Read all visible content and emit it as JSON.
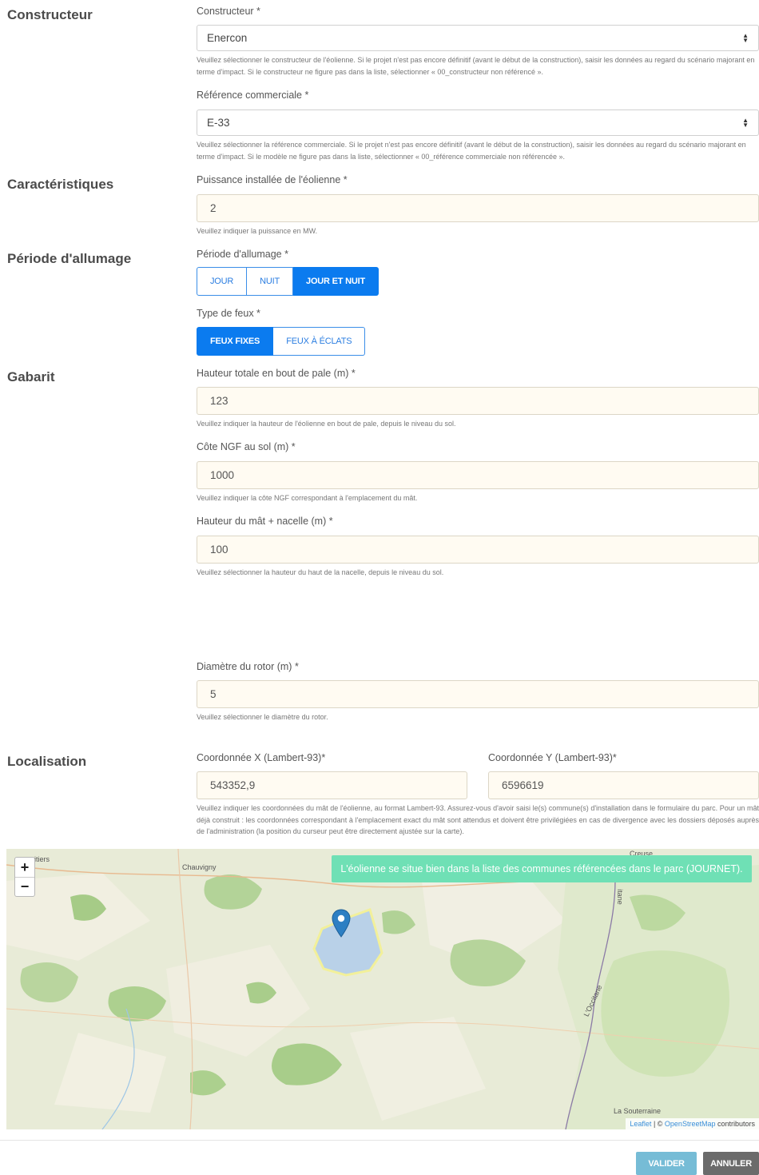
{
  "sections": {
    "constructeur": "Constructeur",
    "caracteristiques": "Caractéristiques",
    "periode": "Période d'allumage",
    "gabarit": "Gabarit",
    "localisation": "Localisation"
  },
  "constructeur": {
    "label": "Constructeur *",
    "value": "Enercon",
    "help": "Veuillez sélectionner le constructeur de l'éolienne. Si le projet n'est pas encore définitif (avant le début de la construction), saisir les données au regard du scénario majorant en terme d'impact. Si le constructeur ne figure pas dans la liste, sélectionner « 00_constructeur non référencé »."
  },
  "reference": {
    "label": "Référence commerciale *",
    "value": "E-33",
    "help": "Veuillez sélectionner la référence commerciale. Si le projet n'est pas encore définitif (avant le début de la construction), saisir les données au regard du scénario majorant en terme d'impact. Si le modèle ne figure pas dans la liste, sélectionner « 00_référence commerciale non référencée »."
  },
  "puissance": {
    "label": "Puissance installée de l'éolienne *",
    "value": "2",
    "help": "Veuillez indiquer la puissance en MW."
  },
  "periode": {
    "label": "Période d'allumage *",
    "options": [
      "JOUR",
      "NUIT",
      "JOUR ET NUIT"
    ],
    "selected": "JOUR ET NUIT"
  },
  "type_feux": {
    "label": "Type de feux *",
    "options": [
      "FEUX FIXES",
      "FEUX À ÉCLATS"
    ],
    "selected": "FEUX FIXES"
  },
  "hauteur_totale": {
    "label": "Hauteur totale en bout de pale (m) *",
    "value": "123",
    "help": "Veuillez indiquer la hauteur de l'éolienne en bout de pale, depuis le niveau du sol."
  },
  "cote_ngf": {
    "label": "Côte NGF au sol (m) *",
    "value": "1000",
    "help": "Veuillez indiquer la côte NGF correspondant à l'emplacement du mât."
  },
  "hauteur_mat": {
    "label": "Hauteur du mât + nacelle (m) *",
    "value": "100",
    "help": "Veuillez sélectionner la hauteur du haut de la nacelle, depuis le niveau du sol."
  },
  "diametre": {
    "label": "Diamètre du rotor (m) *",
    "value": "5",
    "help": "Veuillez sélectionner le diamètre du rotor."
  },
  "coord_x": {
    "label": "Coordonnée X (Lambert-93)*",
    "value": "543352,9"
  },
  "coord_y": {
    "label": "Coordonnée Y (Lambert-93)*",
    "value": "6596619"
  },
  "coord_help": "Veuillez indiquer les coordonnées du mât de l'éolienne, au format Lambert-93. Assurez-vous d'avoir saisi le(s) commune(s) d'installation dans le formulaire du parc. Pour un mât déjà construit : les coordonnées correspondant à l'emplacement exact du mât sont attendus et doivent être privilégiées en cas de divergence avec les dossiers déposés auprès de l'administration (la position du curseur peut être directement ajustée sur la carte).",
  "map": {
    "zoom_in": "+",
    "zoom_out": "−",
    "notice": "L'éolienne se situe bien dans la liste des communes référencées dans le parc (JOURNET).",
    "places": {
      "poitiers": "oitiers",
      "chauvigny": "Chauvigny",
      "creuse": "Creuse",
      "souterraine": "La Souterraine",
      "occitane": "L'Occitane",
      "itane": "itane"
    },
    "attribution": {
      "leaflet": "Leaflet",
      "sep": " | © ",
      "osm": "OpenStreetMap",
      "contributors": " contributors"
    },
    "marker_icon": "map-marker-icon",
    "colors": {
      "notice_bg": "#6fe0b5",
      "marker": "#2d7fc3",
      "zone_fill": "#a9c8ee",
      "zone_border": "#f2f09a"
    }
  },
  "footer": {
    "valider": "VALIDER",
    "annuler": "ANNULER",
    "valider_color": "#76bcd6",
    "annuler_color": "#6b6b6b"
  },
  "colors": {
    "primary": "#0b7bef",
    "input_bg": "#fffbf2"
  }
}
